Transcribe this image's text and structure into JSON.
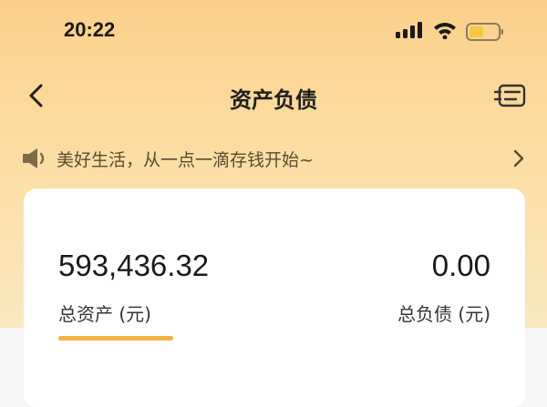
{
  "status_bar": {
    "time": "20:22",
    "signal_icon": "cellular-signal-icon",
    "wifi_icon": "wifi-icon",
    "battery_icon": "battery-icon",
    "battery_level": 0.5,
    "battery_color": "#f5c842"
  },
  "nav": {
    "back_icon": "chevron-left-icon",
    "title": "资产负债",
    "bill_icon": "bill-list-icon"
  },
  "notice": {
    "icon": "speaker-icon",
    "text": "美好生活，从一点一滴存钱开始~",
    "chevron_icon": "chevron-right-icon"
  },
  "summary": {
    "total_assets_value": "593,436.32",
    "total_assets_label": "总资产 (元)",
    "total_debt_value": "0.00",
    "total_debt_label": "总负债 (元)",
    "selected_tab": "总资产 (元)"
  },
  "colors": {
    "header_gradient_top": "#fbd08a",
    "header_gradient_bottom": "#fbe8bf",
    "accent": "#f3b43f",
    "card_background": "#ffffff",
    "page_background": "#f6f6f6"
  }
}
